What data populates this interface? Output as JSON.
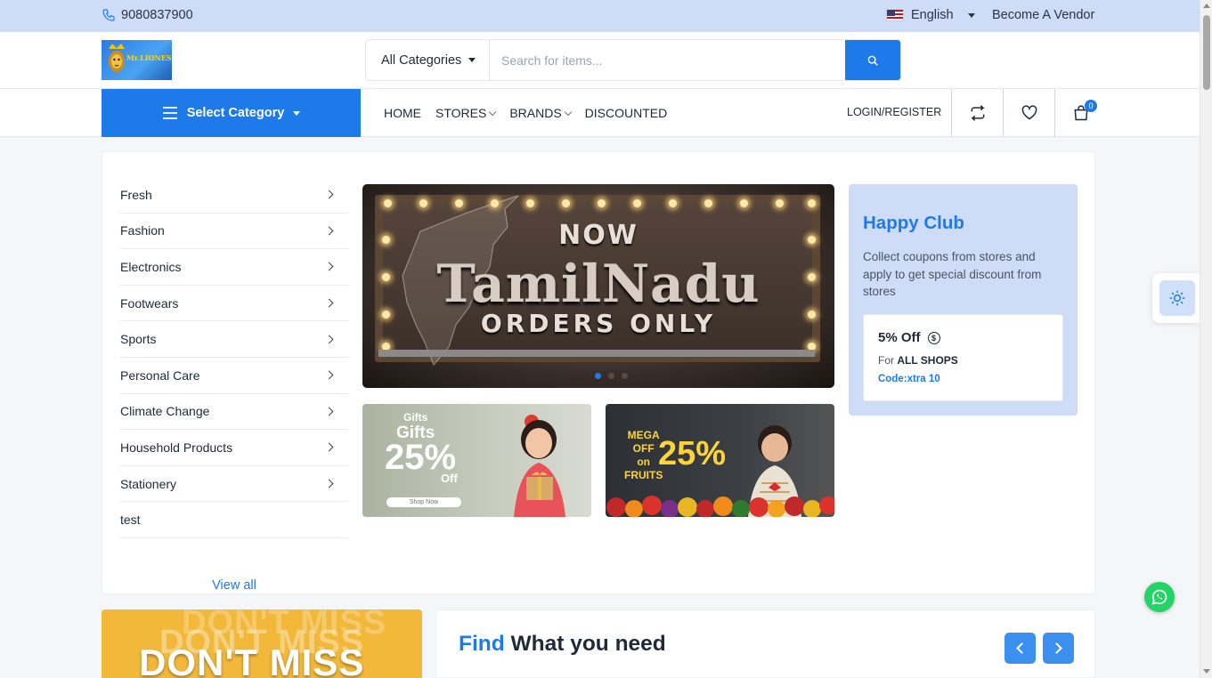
{
  "topbar": {
    "phone": "9080837900",
    "language": "English",
    "vendor_link": "Become A Vendor"
  },
  "header": {
    "logo_text": "Mr.LIONESS",
    "category_select": "All Categories",
    "search_placeholder": "Search for items..."
  },
  "nav": {
    "select_category": "Select Category",
    "items": [
      {
        "label": "HOME",
        "has_dropdown": false
      },
      {
        "label": "STORES",
        "has_dropdown": true
      },
      {
        "label": "BRANDS",
        "has_dropdown": true
      },
      {
        "label": "DISCOUNTED",
        "has_dropdown": false
      }
    ],
    "login": "LOGIN/REGISTER",
    "cart_count": "0"
  },
  "sidebar": {
    "categories": [
      {
        "label": "Fresh",
        "has_children": true
      },
      {
        "label": "Fashion",
        "has_children": true
      },
      {
        "label": "Electronics",
        "has_children": true
      },
      {
        "label": "Footwears",
        "has_children": true
      },
      {
        "label": "Sports",
        "has_children": true
      },
      {
        "label": "Personal Care",
        "has_children": true
      },
      {
        "label": "Climate Change",
        "has_children": true
      },
      {
        "label": "Household Products",
        "has_children": true
      },
      {
        "label": "Stationery",
        "has_children": true
      },
      {
        "label": "test",
        "has_children": false
      }
    ],
    "view_all": "View all"
  },
  "hero": {
    "line1": "NOW",
    "line2": "TamilNadu",
    "line3": "ORDERS ONLY",
    "slide_count": 3,
    "active_slide": 1
  },
  "promo_gifts": {
    "small": "Gifts",
    "title": "Gifts",
    "percent": "25%",
    "off": "Off",
    "button": "Shop Now"
  },
  "promo_fruits": {
    "line1": "MEGA",
    "line2": "OFF",
    "line3": "on",
    "line4": "FRUITS",
    "percent": "25%"
  },
  "happy_club": {
    "title": "Happy Club",
    "description": "Collect coupons from stores and apply to get special discount from stores",
    "coupon": {
      "discount": "5% Off",
      "for_prefix": "For",
      "for_target": "ALL SHOPS",
      "code": "Code:xtra 10"
    }
  },
  "dont_miss": {
    "text": "DON'T MISS"
  },
  "find_section": {
    "title_highlight": "Find",
    "title_rest": "What you need"
  },
  "colors": {
    "primary": "#1e7ae8",
    "topbar_bg": "#cfdcf7",
    "club_bg": "#cfdcf7",
    "whatsapp": "#25d366",
    "dont_miss_bg": "#f1b83a"
  }
}
